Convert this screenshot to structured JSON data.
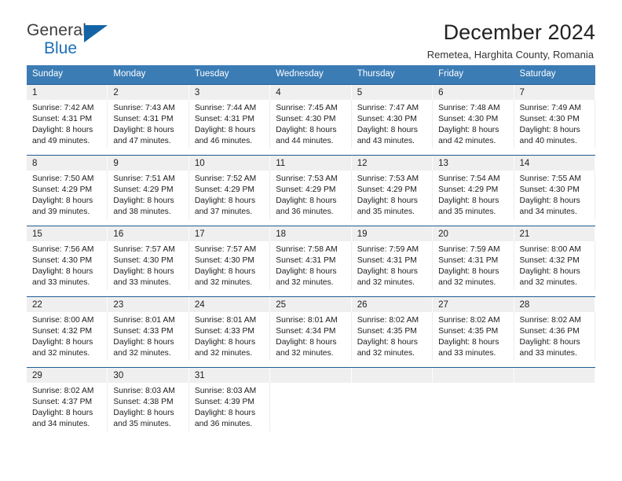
{
  "brand": {
    "name_top": "General",
    "name_bottom": "Blue",
    "triangle_icon": "triangle-icon",
    "colors": {
      "top_text": "#3c3c3c",
      "bottom_text": "#1d6fb8",
      "triangle": "#1464a5"
    }
  },
  "header": {
    "title": "December 2024",
    "location": "Remetea, Harghita County, Romania"
  },
  "theme": {
    "header_row_bg": "#3b7cb5",
    "row_divider": "#1f5c94",
    "daynum_bg": "#efefef",
    "text": "#1c1c1c"
  },
  "labels": {
    "sunrise_prefix": "Sunrise:",
    "sunset_prefix": "Sunset:",
    "daylight_prefix": "Daylight:"
  },
  "weekdays": [
    "Sunday",
    "Monday",
    "Tuesday",
    "Wednesday",
    "Thursday",
    "Friday",
    "Saturday"
  ],
  "weeks": [
    [
      {
        "day": "1",
        "sunrise": "Sunrise: 7:42 AM",
        "sunset": "Sunset: 4:31 PM",
        "daylight_line1": "Daylight: 8 hours",
        "daylight_line2": "and 49 minutes."
      },
      {
        "day": "2",
        "sunrise": "Sunrise: 7:43 AM",
        "sunset": "Sunset: 4:31 PM",
        "daylight_line1": "Daylight: 8 hours",
        "daylight_line2": "and 47 minutes."
      },
      {
        "day": "3",
        "sunrise": "Sunrise: 7:44 AM",
        "sunset": "Sunset: 4:31 PM",
        "daylight_line1": "Daylight: 8 hours",
        "daylight_line2": "and 46 minutes."
      },
      {
        "day": "4",
        "sunrise": "Sunrise: 7:45 AM",
        "sunset": "Sunset: 4:30 PM",
        "daylight_line1": "Daylight: 8 hours",
        "daylight_line2": "and 44 minutes."
      },
      {
        "day": "5",
        "sunrise": "Sunrise: 7:47 AM",
        "sunset": "Sunset: 4:30 PM",
        "daylight_line1": "Daylight: 8 hours",
        "daylight_line2": "and 43 minutes."
      },
      {
        "day": "6",
        "sunrise": "Sunrise: 7:48 AM",
        "sunset": "Sunset: 4:30 PM",
        "daylight_line1": "Daylight: 8 hours",
        "daylight_line2": "and 42 minutes."
      },
      {
        "day": "7",
        "sunrise": "Sunrise: 7:49 AM",
        "sunset": "Sunset: 4:30 PM",
        "daylight_line1": "Daylight: 8 hours",
        "daylight_line2": "and 40 minutes."
      }
    ],
    [
      {
        "day": "8",
        "sunrise": "Sunrise: 7:50 AM",
        "sunset": "Sunset: 4:29 PM",
        "daylight_line1": "Daylight: 8 hours",
        "daylight_line2": "and 39 minutes."
      },
      {
        "day": "9",
        "sunrise": "Sunrise: 7:51 AM",
        "sunset": "Sunset: 4:29 PM",
        "daylight_line1": "Daylight: 8 hours",
        "daylight_line2": "and 38 minutes."
      },
      {
        "day": "10",
        "sunrise": "Sunrise: 7:52 AM",
        "sunset": "Sunset: 4:29 PM",
        "daylight_line1": "Daylight: 8 hours",
        "daylight_line2": "and 37 minutes."
      },
      {
        "day": "11",
        "sunrise": "Sunrise: 7:53 AM",
        "sunset": "Sunset: 4:29 PM",
        "daylight_line1": "Daylight: 8 hours",
        "daylight_line2": "and 36 minutes."
      },
      {
        "day": "12",
        "sunrise": "Sunrise: 7:53 AM",
        "sunset": "Sunset: 4:29 PM",
        "daylight_line1": "Daylight: 8 hours",
        "daylight_line2": "and 35 minutes."
      },
      {
        "day": "13",
        "sunrise": "Sunrise: 7:54 AM",
        "sunset": "Sunset: 4:29 PM",
        "daylight_line1": "Daylight: 8 hours",
        "daylight_line2": "and 35 minutes."
      },
      {
        "day": "14",
        "sunrise": "Sunrise: 7:55 AM",
        "sunset": "Sunset: 4:30 PM",
        "daylight_line1": "Daylight: 8 hours",
        "daylight_line2": "and 34 minutes."
      }
    ],
    [
      {
        "day": "15",
        "sunrise": "Sunrise: 7:56 AM",
        "sunset": "Sunset: 4:30 PM",
        "daylight_line1": "Daylight: 8 hours",
        "daylight_line2": "and 33 minutes."
      },
      {
        "day": "16",
        "sunrise": "Sunrise: 7:57 AM",
        "sunset": "Sunset: 4:30 PM",
        "daylight_line1": "Daylight: 8 hours",
        "daylight_line2": "and 33 minutes."
      },
      {
        "day": "17",
        "sunrise": "Sunrise: 7:57 AM",
        "sunset": "Sunset: 4:30 PM",
        "daylight_line1": "Daylight: 8 hours",
        "daylight_line2": "and 32 minutes."
      },
      {
        "day": "18",
        "sunrise": "Sunrise: 7:58 AM",
        "sunset": "Sunset: 4:31 PM",
        "daylight_line1": "Daylight: 8 hours",
        "daylight_line2": "and 32 minutes."
      },
      {
        "day": "19",
        "sunrise": "Sunrise: 7:59 AM",
        "sunset": "Sunset: 4:31 PM",
        "daylight_line1": "Daylight: 8 hours",
        "daylight_line2": "and 32 minutes."
      },
      {
        "day": "20",
        "sunrise": "Sunrise: 7:59 AM",
        "sunset": "Sunset: 4:31 PM",
        "daylight_line1": "Daylight: 8 hours",
        "daylight_line2": "and 32 minutes."
      },
      {
        "day": "21",
        "sunrise": "Sunrise: 8:00 AM",
        "sunset": "Sunset: 4:32 PM",
        "daylight_line1": "Daylight: 8 hours",
        "daylight_line2": "and 32 minutes."
      }
    ],
    [
      {
        "day": "22",
        "sunrise": "Sunrise: 8:00 AM",
        "sunset": "Sunset: 4:32 PM",
        "daylight_line1": "Daylight: 8 hours",
        "daylight_line2": "and 32 minutes."
      },
      {
        "day": "23",
        "sunrise": "Sunrise: 8:01 AM",
        "sunset": "Sunset: 4:33 PM",
        "daylight_line1": "Daylight: 8 hours",
        "daylight_line2": "and 32 minutes."
      },
      {
        "day": "24",
        "sunrise": "Sunrise: 8:01 AM",
        "sunset": "Sunset: 4:33 PM",
        "daylight_line1": "Daylight: 8 hours",
        "daylight_line2": "and 32 minutes."
      },
      {
        "day": "25",
        "sunrise": "Sunrise: 8:01 AM",
        "sunset": "Sunset: 4:34 PM",
        "daylight_line1": "Daylight: 8 hours",
        "daylight_line2": "and 32 minutes."
      },
      {
        "day": "26",
        "sunrise": "Sunrise: 8:02 AM",
        "sunset": "Sunset: 4:35 PM",
        "daylight_line1": "Daylight: 8 hours",
        "daylight_line2": "and 32 minutes."
      },
      {
        "day": "27",
        "sunrise": "Sunrise: 8:02 AM",
        "sunset": "Sunset: 4:35 PM",
        "daylight_line1": "Daylight: 8 hours",
        "daylight_line2": "and 33 minutes."
      },
      {
        "day": "28",
        "sunrise": "Sunrise: 8:02 AM",
        "sunset": "Sunset: 4:36 PM",
        "daylight_line1": "Daylight: 8 hours",
        "daylight_line2": "and 33 minutes."
      }
    ],
    [
      {
        "day": "29",
        "sunrise": "Sunrise: 8:02 AM",
        "sunset": "Sunset: 4:37 PM",
        "daylight_line1": "Daylight: 8 hours",
        "daylight_line2": "and 34 minutes."
      },
      {
        "day": "30",
        "sunrise": "Sunrise: 8:03 AM",
        "sunset": "Sunset: 4:38 PM",
        "daylight_line1": "Daylight: 8 hours",
        "daylight_line2": "and 35 minutes."
      },
      {
        "day": "31",
        "sunrise": "Sunrise: 8:03 AM",
        "sunset": "Sunset: 4:39 PM",
        "daylight_line1": "Daylight: 8 hours",
        "daylight_line2": "and 36 minutes."
      },
      {
        "day": "",
        "sunrise": "",
        "sunset": "",
        "daylight_line1": "",
        "daylight_line2": ""
      },
      {
        "day": "",
        "sunrise": "",
        "sunset": "",
        "daylight_line1": "",
        "daylight_line2": ""
      },
      {
        "day": "",
        "sunrise": "",
        "sunset": "",
        "daylight_line1": "",
        "daylight_line2": ""
      },
      {
        "day": "",
        "sunrise": "",
        "sunset": "",
        "daylight_line1": "",
        "daylight_line2": ""
      }
    ]
  ]
}
